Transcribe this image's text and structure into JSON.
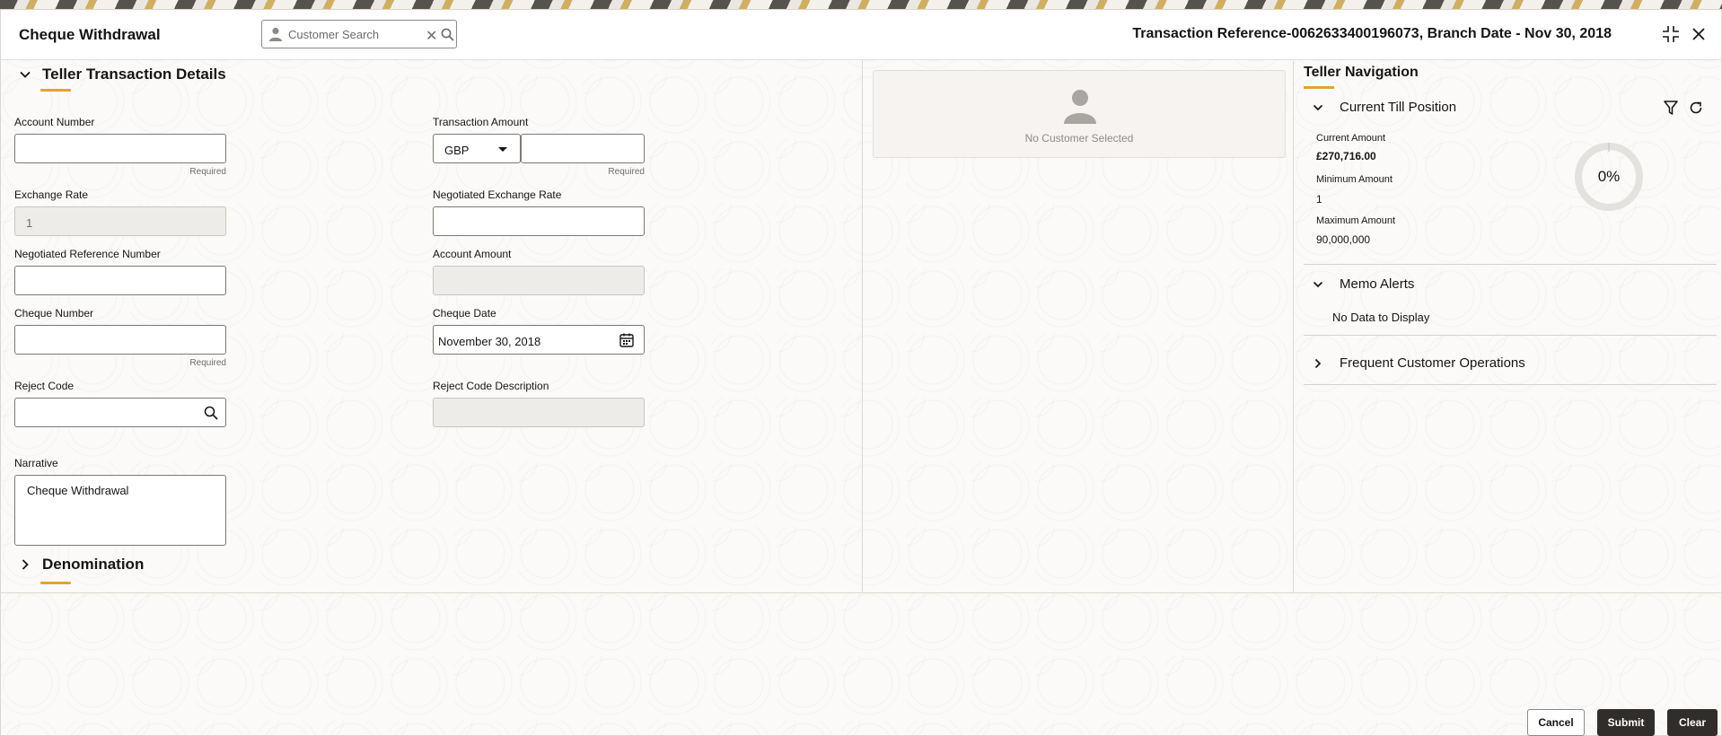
{
  "header": {
    "title": "Cheque Withdrawal",
    "search_placeholder": "Customer Search",
    "transaction_ref": "Transaction Reference-0062633400196073, Branch Date - Nov 30, 2018"
  },
  "teller_details": {
    "section_title": "Teller Transaction Details",
    "account_number": {
      "label": "Account Number",
      "value": "",
      "hint": "Required"
    },
    "transaction_amount": {
      "label": "Transaction Amount",
      "currency": "GBP",
      "value": "",
      "hint": "Required"
    },
    "exchange_rate": {
      "label": "Exchange Rate",
      "value": "1"
    },
    "negotiated_exchange_rate": {
      "label": "Negotiated Exchange Rate",
      "value": ""
    },
    "negotiated_reference_number": {
      "label": "Negotiated Reference Number",
      "value": ""
    },
    "account_amount": {
      "label": "Account Amount",
      "value": ""
    },
    "cheque_number": {
      "label": "Cheque Number",
      "value": "",
      "hint": "Required"
    },
    "cheque_date": {
      "label": "Cheque Date",
      "value": "November 30, 2018"
    },
    "reject_code": {
      "label": "Reject Code",
      "value": ""
    },
    "reject_code_description": {
      "label": "Reject Code Description",
      "value": ""
    },
    "narrative": {
      "label": "Narrative",
      "value": "Cheque Withdrawal"
    }
  },
  "denomination": {
    "section_title": "Denomination"
  },
  "customer": {
    "empty_text": "No Customer Selected"
  },
  "teller_navigation": {
    "title": "Teller Navigation",
    "till": {
      "title": "Current Till Position",
      "current_amount_label": "Current Amount",
      "current_amount": "£270,716.00",
      "minimum_amount_label": "Minimum Amount",
      "minimum_amount": "1",
      "maximum_amount_label": "Maximum Amount",
      "maximum_amount": "90,000,000",
      "utilization": "0%"
    },
    "memo_alerts": {
      "title": "Memo Alerts",
      "empty_text": "No Data to Display"
    },
    "frequent_ops": {
      "title": "Frequent Customer Operations"
    }
  },
  "footer": {
    "cancel": "Cancel",
    "submit": "Submit",
    "clear": "Clear"
  },
  "colors": {
    "accent": "#e2a33b",
    "primary_dark": "#312d2a"
  },
  "icons": [
    "person-icon",
    "clear-icon",
    "search-icon",
    "collapse-icon",
    "close-icon",
    "chevron-down-icon",
    "chevron-right-icon",
    "calendar-icon",
    "filter-icon",
    "refresh-icon",
    "avatar-icon"
  ]
}
